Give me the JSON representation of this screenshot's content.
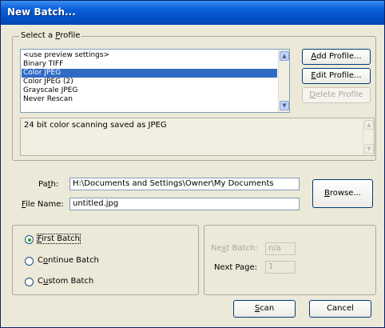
{
  "window": {
    "title": "New Batch..."
  },
  "profile_group": {
    "legend_pre": "Select a ",
    "legend_key": "P",
    "legend_post": "rofile",
    "items": [
      "<use preview settings>",
      "Binary TIFF",
      "Color JPEG",
      "Color JPEG (2)",
      "Grayscale JPEG",
      "Never Rescan"
    ],
    "selected_index": 2,
    "description": "24 bit color scanning saved as JPEG",
    "add_profile": {
      "key": "A",
      "rest": "dd Profile..."
    },
    "edit_profile": {
      "key": "E",
      "rest": "dit Profile..."
    },
    "delete_profile": {
      "key": "D",
      "rest": "elete Profile"
    }
  },
  "paths": {
    "path_label_pre": "Pa",
    "path_label_key": "t",
    "path_label_post": "h:",
    "path_value": "H:\\Documents and Settings\\Owner\\My Documents",
    "file_label_key": "F",
    "file_label_post": "ile Name:",
    "file_value": "untitled.jpg",
    "browse": {
      "key": "B",
      "rest": "rowse..."
    }
  },
  "batch_mode": {
    "selected": "first",
    "first": {
      "key": "F",
      "rest": "irst Batch"
    },
    "continue": {
      "pre": "C",
      "key": "o",
      "rest": "ntinue Batch"
    },
    "custom": {
      "pre": "C",
      "key": "u",
      "rest": "stom Batch"
    }
  },
  "numbers": {
    "next_batch_pre": "Ne",
    "next_batch_key": "x",
    "next_batch_post": "t Batch:",
    "next_batch_value": "n/a",
    "next_page_label": "Next Page:",
    "next_page_value": "1"
  },
  "footer": {
    "scan": {
      "key": "S",
      "rest": "can"
    },
    "cancel": "Cancel"
  }
}
